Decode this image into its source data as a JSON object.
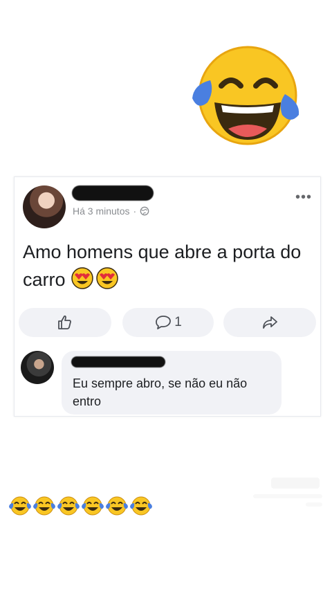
{
  "post": {
    "time_label": "Há 3 minutos",
    "separator": "·",
    "privacy_icon": "globe-icon",
    "more_icon": "more-options-icon",
    "more_label": "•••",
    "text": "Amo homens que abre a porta do carro",
    "text_emojis": [
      "heart-eyes-emoji",
      "heart-eyes-emoji"
    ]
  },
  "actions": {
    "like_icon": "thumbs-up-icon",
    "comment_icon": "comment-icon",
    "comment_count": "1",
    "share_icon": "share-icon"
  },
  "comment": {
    "text": "Eu sempre abro, se não eu não entro"
  },
  "decor": {
    "top_emoji": "tears-of-joy-emoji",
    "bottom_emoji_count": 6,
    "emoji_yellow": "#f9c623",
    "emoji_blue": "#4a7fe0"
  }
}
